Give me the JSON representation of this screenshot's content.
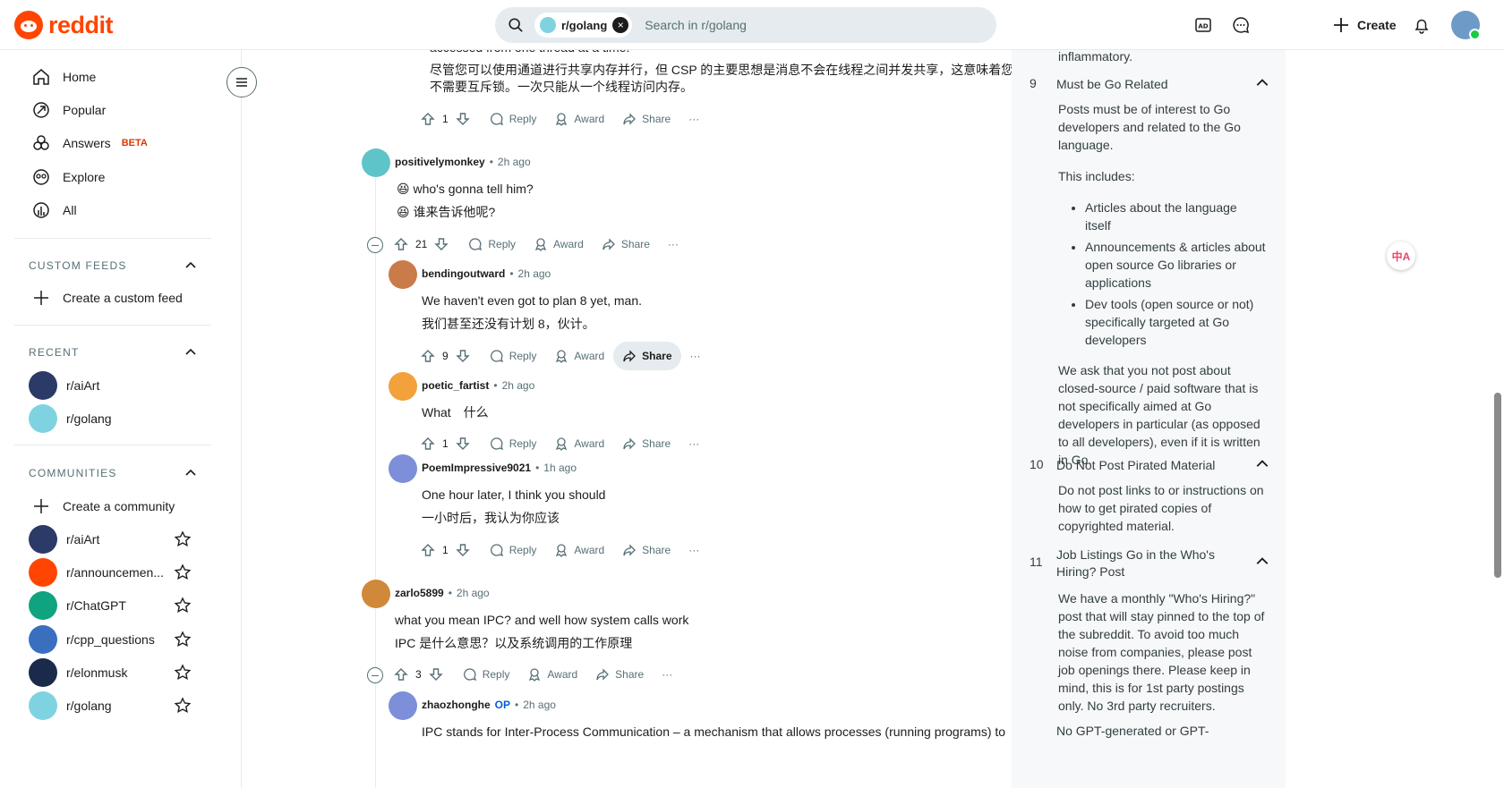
{
  "header": {
    "logo_text": "reddit",
    "search_chip": "r/golang",
    "search_placeholder": "Search in r/golang",
    "create_label": "Create"
  },
  "sidebar": {
    "nav": [
      {
        "label": "Home",
        "icon": "home-icon"
      },
      {
        "label": "Popular",
        "icon": "popular-icon"
      },
      {
        "label": "Answers",
        "icon": "answers-icon",
        "badge": "BETA"
      },
      {
        "label": "Explore",
        "icon": "explore-icon"
      },
      {
        "label": "All",
        "icon": "all-icon"
      }
    ],
    "custom_feeds": {
      "title": "CUSTOM FEEDS",
      "create_label": "Create a custom feed"
    },
    "recent": {
      "title": "RECENT",
      "items": [
        {
          "label": "r/aiArt",
          "color": "#2b3a66"
        },
        {
          "label": "r/golang",
          "color": "#7fd3e0"
        }
      ]
    },
    "communities": {
      "title": "COMMUNITIES",
      "create_label": "Create a community",
      "items": [
        {
          "label": "r/aiArt",
          "color": "#2b3a66"
        },
        {
          "label": "r/announcemen...",
          "color": "#ff4500"
        },
        {
          "label": "r/ChatGPT",
          "color": "#10a37f"
        },
        {
          "label": "r/cpp_questions",
          "color": "#3a6fc0"
        },
        {
          "label": "r/elonmusk",
          "color": "#1b2a4a"
        },
        {
          "label": "r/golang",
          "color": "#7fd3e0"
        }
      ]
    }
  },
  "comments": {
    "top_partial": {
      "line1": "accessed from one thread at a time.",
      "line2": "尽管您可以使用通道进行共享内存并行，但 CSP 的主要思想是消息不会在线程之间并发共享，这意味着您",
      "line3": "不需要互斥锁。一次只能从一个线程访问内存。",
      "votes": "1"
    },
    "c1": {
      "user": "positivelymonkey",
      "time": "2h ago",
      "line1": "who's gonna tell him?",
      "line2": "谁来告诉他呢?",
      "votes": "21"
    },
    "c2": {
      "user": "bendingoutward",
      "time": "2h ago",
      "line1": "We haven't even got to plan 8 yet, man.",
      "line2": "我们甚至还没有计划 8，伙计。",
      "votes": "9"
    },
    "c3": {
      "user": "poetic_fartist",
      "time": "2h ago",
      "line1": "What　什么",
      "votes": "1"
    },
    "c4": {
      "user": "PoemImpressive9021",
      "time": "1h ago",
      "line1": "One hour later, I think you should",
      "line2": "一小时后，我认为你应该",
      "votes": "1"
    },
    "c5": {
      "user": "zarlo5899",
      "time": "2h ago",
      "line1": "what you mean IPC? and well how system calls work",
      "line2": "IPC 是什么意思？以及系统调用的工作原理",
      "votes": "3"
    },
    "c6": {
      "user": "zhaozhonghe",
      "op": "OP",
      "time": "2h ago",
      "line1": "IPC stands for Inter-Process Communication – a mechanism that allows processes (running programs) to"
    },
    "labels": {
      "reply": "Reply",
      "award": "Award",
      "share": "Share",
      "dot": "•"
    }
  },
  "rules": {
    "top_partial": "inflammatory.",
    "r9": {
      "num": "9",
      "title": "Must be Go Related",
      "p1": "Posts must be of interest to Go developers and related to the Go language.",
      "p2": "This includes:",
      "bullets": [
        "Articles about the language itself",
        "Announcements & articles about open source Go libraries or applications",
        "Dev tools (open source or not) specifically targeted at Go developers"
      ],
      "p3": "We ask that you not post about closed-source / paid software that is not specifically aimed at Go developers in particular (as opposed to all developers), even if it is written in Go."
    },
    "r10": {
      "num": "10",
      "title": "Do Not Post Pirated Material",
      "p1": "Do not post links to or instructions on how to get pirated copies of copyrighted material."
    },
    "r11": {
      "num": "11",
      "title": "Job Listings Go in the Who's Hiring? Post",
      "p1": "We have a monthly \"Who's Hiring?\" post that will stay pinned to the top of the subreddit. To avoid too much noise from companies, please post job openings there. Please keep in mind, this is for 1st party postings only. No 3rd party recruiters."
    },
    "r12_partial": "No GPT-generated or GPT-"
  },
  "translate_fab": "中A"
}
